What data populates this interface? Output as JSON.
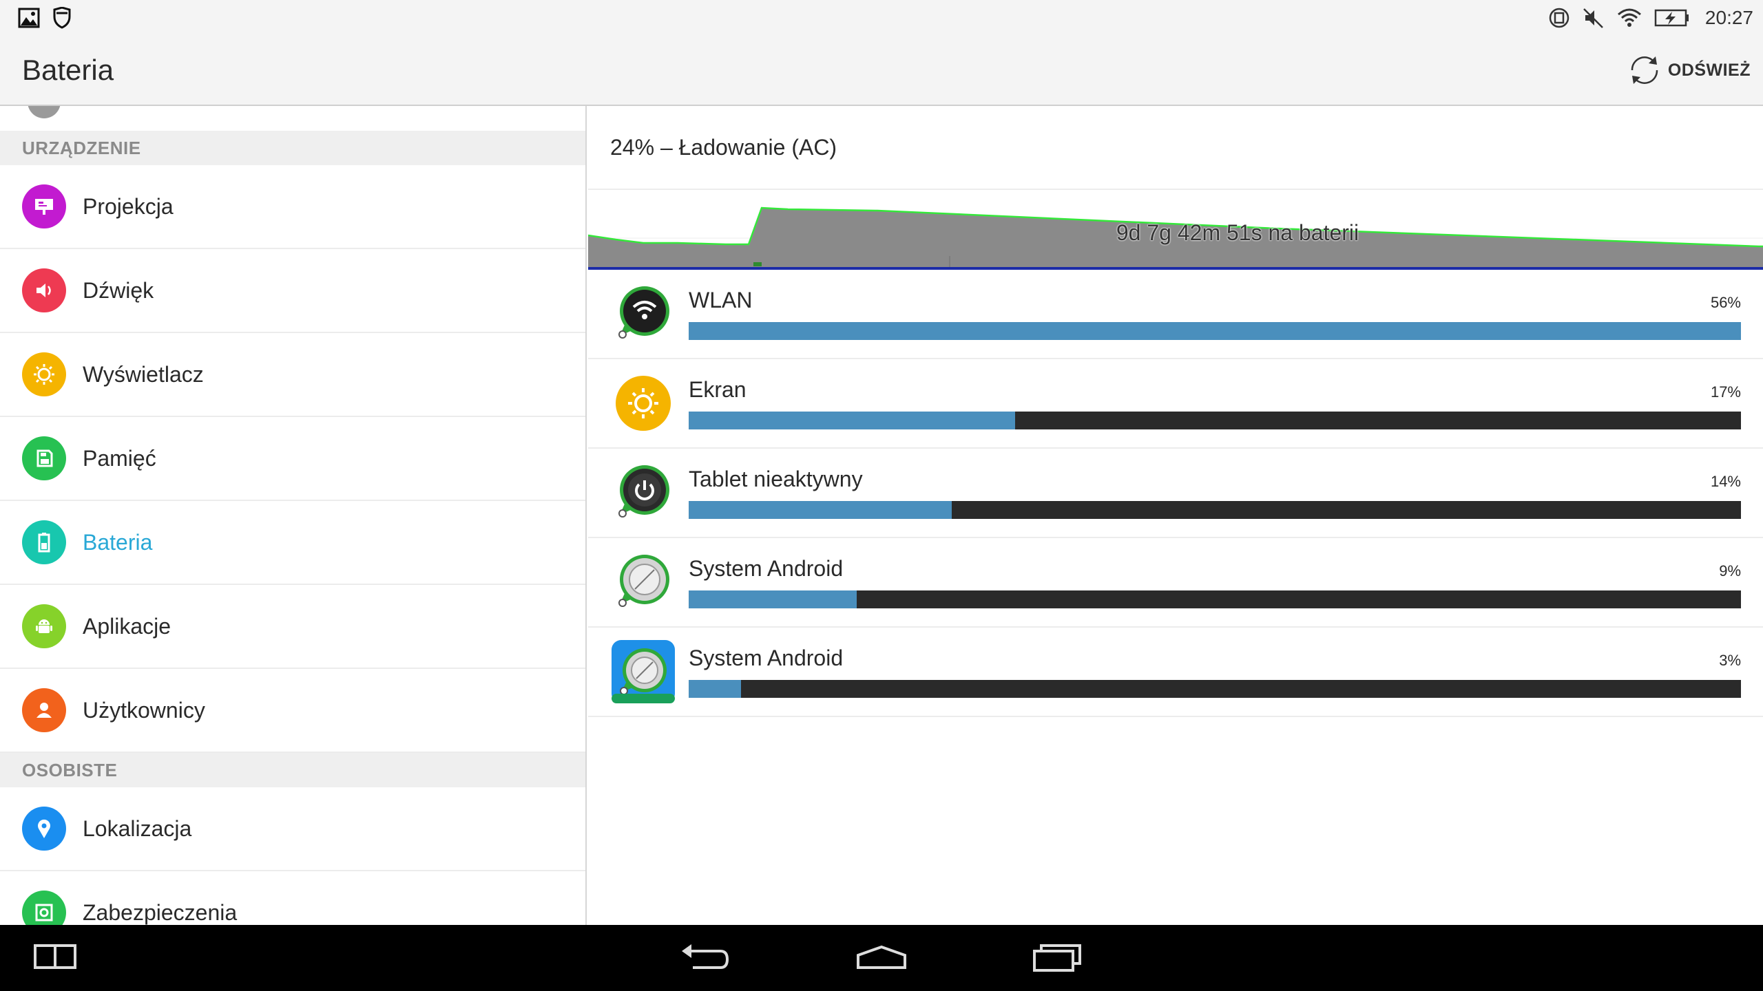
{
  "status_bar": {
    "time": "20:27"
  },
  "header": {
    "title": "Bateria",
    "refresh_label": "ODŚWIEŻ"
  },
  "settings": {
    "sections": [
      {
        "header": "URZĄDZENIE"
      },
      {
        "header": "OSOBISTE"
      }
    ],
    "items": [
      {
        "label": "Projekcja",
        "color": "#c21bd0",
        "icon": "projection-icon"
      },
      {
        "label": "Dźwięk",
        "color": "#ee3a52",
        "icon": "volume-icon"
      },
      {
        "label": "Wyświetlacz",
        "color": "#f5b400",
        "icon": "brightness-icon"
      },
      {
        "label": "Pamięć",
        "color": "#27c152",
        "icon": "storage-icon"
      },
      {
        "label": "Bateria",
        "color": "#18c7ae",
        "icon": "battery-icon",
        "active": true
      },
      {
        "label": "Aplikacje",
        "color": "#86d22a",
        "icon": "android-icon"
      },
      {
        "label": "Użytkownicy",
        "color": "#f2621c",
        "icon": "user-icon"
      },
      {
        "label": "Lokalizacja",
        "color": "#1a8ef0",
        "icon": "location-icon"
      },
      {
        "label": "Zabezpieczenia",
        "color": "#27c152",
        "icon": "security-icon"
      }
    ]
  },
  "battery": {
    "status": "24% – Ładowanie (AC)",
    "graph_label": "9d 7g 42m 51s na baterii",
    "usage": [
      {
        "name": "WLAN",
        "percent": "56%",
        "fraction": 1.0
      },
      {
        "name": "Ekran",
        "percent": "17%",
        "fraction": 0.31
      },
      {
        "name": "Tablet nieaktywny",
        "percent": "14%",
        "fraction": 0.25
      },
      {
        "name": "System Android",
        "percent": "9%",
        "fraction": 0.16
      },
      {
        "name": "System Android",
        "percent": "3%",
        "fraction": 0.05
      }
    ]
  },
  "colors": {
    "accent": "#29a8d6",
    "bar_fill": "#4a8fbd",
    "bar_track": "#2a2a2a"
  }
}
